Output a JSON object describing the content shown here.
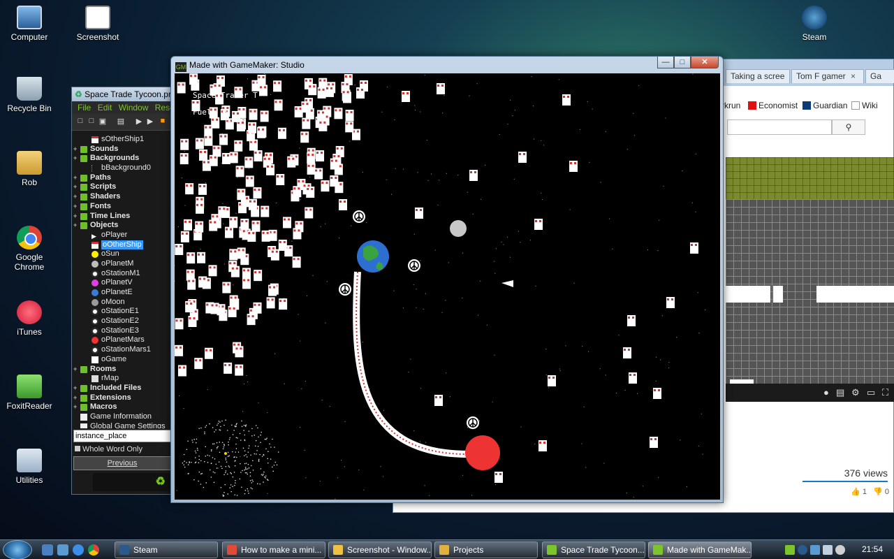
{
  "desktop": {
    "icons": [
      {
        "label": "Computer",
        "icon": "computer-icon"
      },
      {
        "label": "Screenshot",
        "icon": "screenshot-icon"
      },
      {
        "label": "Steam",
        "icon": "steam-icon"
      },
      {
        "label": "Recycle Bin",
        "icon": "recycle-bin-icon"
      },
      {
        "label": "Rob",
        "icon": "folder-icon"
      },
      {
        "label": "Google Chrome",
        "icon": "chrome-icon"
      },
      {
        "label": "iTunes",
        "icon": "itunes-icon"
      },
      {
        "label": "FoxitReader",
        "icon": "foxit-icon"
      },
      {
        "label": "Utilities",
        "icon": "utilities-icon"
      }
    ]
  },
  "browser": {
    "tabs": [
      {
        "label": "Taking a scree"
      },
      {
        "label": "Tom F gamer"
      },
      {
        "label": "Ga"
      }
    ],
    "tab_close": "×",
    "bookmarks": [
      {
        "label": "rkrun"
      },
      {
        "label": "Economist"
      },
      {
        "label": "Guardian"
      },
      {
        "label": "Wiki"
      }
    ],
    "views": "376 views",
    "likes": "1",
    "dislikes": "0"
  },
  "ide": {
    "title": "Space Trade Tycoon.project",
    "menu": [
      "File",
      "Edit",
      "Window",
      "Resources"
    ],
    "tree": [
      {
        "label": "sOtherShip1",
        "indent": 2,
        "kind": "sprite"
      },
      {
        "label": "Sounds",
        "indent": 0,
        "kind": "folder"
      },
      {
        "label": "Backgrounds",
        "indent": 0,
        "kind": "folder"
      },
      {
        "label": "bBackground0",
        "indent": 2,
        "kind": "bg"
      },
      {
        "label": "Paths",
        "indent": 0,
        "kind": "folder"
      },
      {
        "label": "Scripts",
        "indent": 0,
        "kind": "folder"
      },
      {
        "label": "Shaders",
        "indent": 0,
        "kind": "folder"
      },
      {
        "label": "Fonts",
        "indent": 0,
        "kind": "folder"
      },
      {
        "label": "Time Lines",
        "indent": 0,
        "kind": "folder"
      },
      {
        "label": "Objects",
        "indent": 0,
        "kind": "folder"
      },
      {
        "label": "oPlayer",
        "indent": 2,
        "kind": "arrow"
      },
      {
        "label": "oOtherShip",
        "indent": 2,
        "kind": "ship",
        "selected": true
      },
      {
        "label": "oSun",
        "indent": 2,
        "kind": "dot",
        "color": "#ffee00"
      },
      {
        "label": "oPlanetM",
        "indent": 2,
        "kind": "dot",
        "color": "#bdbdbd"
      },
      {
        "label": "oStationM1",
        "indent": 2,
        "kind": "station"
      },
      {
        "label": "oPlanetV",
        "indent": 2,
        "kind": "dot",
        "color": "#e040e0"
      },
      {
        "label": "oPlanetE",
        "indent": 2,
        "kind": "dot",
        "color": "#3a7bd5"
      },
      {
        "label": "oMoon",
        "indent": 2,
        "kind": "dot",
        "color": "#9a9a9a"
      },
      {
        "label": "oStationE1",
        "indent": 2,
        "kind": "station"
      },
      {
        "label": "oStationE2",
        "indent": 2,
        "kind": "station"
      },
      {
        "label": "oStationE3",
        "indent": 2,
        "kind": "station"
      },
      {
        "label": "oPlanetMars",
        "indent": 2,
        "kind": "dot",
        "color": "#ee3333"
      },
      {
        "label": "oStationMars1",
        "indent": 2,
        "kind": "station"
      },
      {
        "label": "oGame",
        "indent": 2,
        "kind": "square"
      },
      {
        "label": "Rooms",
        "indent": 0,
        "kind": "folder"
      },
      {
        "label": "rMap",
        "indent": 2,
        "kind": "room"
      },
      {
        "label": "Included Files",
        "indent": 0,
        "kind": "folder"
      },
      {
        "label": "Extensions",
        "indent": 0,
        "kind": "folder"
      },
      {
        "label": "Macros",
        "indent": 0,
        "kind": "folder"
      },
      {
        "label": "Game Information",
        "indent": 0,
        "kind": "info"
      },
      {
        "label": "Global Game Settings",
        "indent": 0,
        "kind": "info"
      }
    ],
    "search_value": "instance_place",
    "whole_word": "Whole Word Only",
    "previous": "Previous"
  },
  "game_window": {
    "title": "Made with GameMaker: Studio",
    "hud_title": "Space Trader T",
    "hud_fuel": "Fuel: 19"
  },
  "taskbar": {
    "tasks": [
      {
        "label": "Steam",
        "color": "#2a5a8a"
      },
      {
        "label": "How to make a mini...",
        "color": "#e04a3a"
      },
      {
        "label": "Screenshot - Window...",
        "color": "#f0c040"
      },
      {
        "label": "Projects",
        "color": "#e0b040"
      },
      {
        "label": "Space Trade Tycoon...",
        "color": "#7cc42b"
      },
      {
        "label": "Made with GameMak...",
        "color": "#7cc42b"
      }
    ],
    "clock": "21:54"
  }
}
